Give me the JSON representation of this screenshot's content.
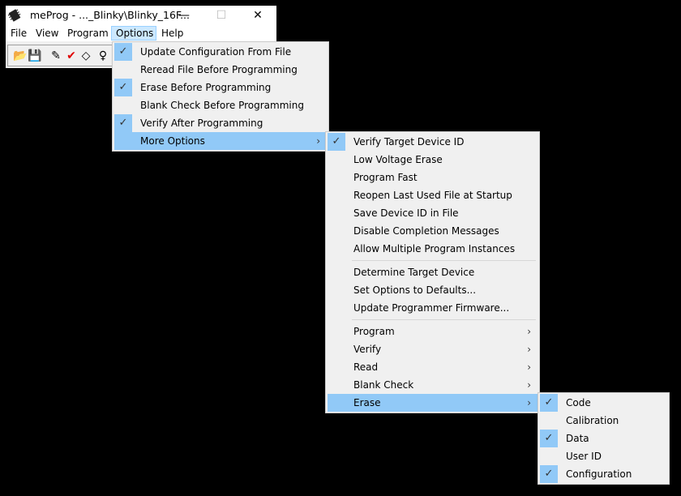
{
  "window": {
    "title": "meProg - ..._Blinky\\Blinky_16F...",
    "controls": {
      "minimize": "—",
      "maximize": "☐",
      "close": "✕"
    },
    "menubar": [
      "File",
      "View",
      "Program",
      "Options",
      "Help"
    ],
    "active_menu": "Options",
    "toolbar": [
      {
        "icon": "open-folder-icon",
        "glyph": "📂"
      },
      {
        "icon": "save-disk-icon",
        "glyph": "💾"
      },
      {
        "icon": "program-chip-icon",
        "glyph": "✎"
      },
      {
        "icon": "verify-check-icon",
        "glyph": "✔"
      },
      {
        "icon": "erase-eraser-icon",
        "glyph": "◇"
      },
      {
        "icon": "lightbulb-icon",
        "glyph": "♀"
      }
    ]
  },
  "colors": {
    "highlight": "#91c9f7",
    "menu_bg": "#f0f0f0",
    "menubar_active": "#cce8ff",
    "check_color": "#333333",
    "checkmark_red": "#e00000"
  },
  "menus": {
    "options": [
      {
        "label": "Update Configuration From File",
        "checked": true
      },
      {
        "label": "Reread File Before Programming",
        "checked": false
      },
      {
        "label": "Erase Before Programming",
        "checked": true
      },
      {
        "label": "Blank Check Before Programming",
        "checked": false
      },
      {
        "label": "Verify After Programming",
        "checked": true
      },
      {
        "label": "More Options",
        "checked": false,
        "submenu": true,
        "highlighted": true
      }
    ],
    "more_options": [
      {
        "label": "Verify Target Device ID",
        "checked": true
      },
      {
        "label": "Low Voltage Erase",
        "checked": false
      },
      {
        "label": "Program Fast",
        "checked": false
      },
      {
        "label": "Reopen Last Used File at Startup",
        "checked": false
      },
      {
        "label": "Save Device ID in File",
        "checked": false
      },
      {
        "label": "Disable Completion Messages",
        "checked": false
      },
      {
        "label": "Allow Multiple Program Instances",
        "checked": false
      },
      {
        "separator": true
      },
      {
        "label": "Determine Target Device",
        "checked": false
      },
      {
        "label": "Set Options to Defaults...",
        "checked": false
      },
      {
        "label": "Update Programmer Firmware...",
        "checked": false
      },
      {
        "separator": true
      },
      {
        "label": "Program",
        "submenu": true
      },
      {
        "label": "Verify",
        "submenu": true
      },
      {
        "label": "Read",
        "submenu": true
      },
      {
        "label": "Blank Check",
        "submenu": true
      },
      {
        "label": "Erase",
        "submenu": true,
        "highlighted": true
      }
    ],
    "erase": [
      {
        "label": "Code",
        "checked": true
      },
      {
        "label": "Calibration",
        "checked": false
      },
      {
        "label": "Data",
        "checked": true
      },
      {
        "label": "User ID",
        "checked": false
      },
      {
        "label": "Configuration",
        "checked": true
      }
    ],
    "check_glyph": "✓",
    "arrow_glyph": "›"
  }
}
